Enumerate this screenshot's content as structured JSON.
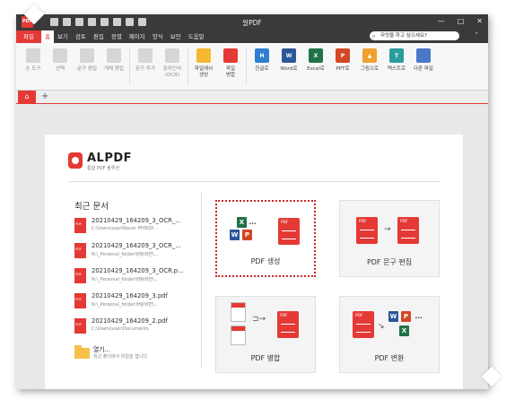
{
  "window": {
    "title": "알PDF",
    "logo_text": "PDF",
    "minimize": "—",
    "maximize": "□",
    "close": "✕"
  },
  "menu": {
    "items": [
      "파일",
      "홈",
      "보기",
      "검토",
      "편집",
      "정렬",
      "페이지",
      "양식",
      "보안",
      "도움말"
    ],
    "search_placeholder": "무엇을 하고 싶으세요?",
    "collapse": "⌃"
  },
  "ribbon": {
    "buttons": [
      {
        "label": "손 도구",
        "icon": "hand-icon",
        "dim": true
      },
      {
        "label": "선택",
        "icon": "select-icon",
        "dim": true
      },
      {
        "label": "문구 편집",
        "icon": "text-edit-icon",
        "dim": true
      },
      {
        "label": "개체 편집",
        "icon": "object-edit-icon",
        "dim": true
      },
      {
        "label": "문구 추가",
        "icon": "add-text-icon",
        "dim": true
      },
      {
        "label": "문자인식\n(OCR)",
        "icon": "ocr-icon",
        "dim": true
      },
      {
        "label": "파일에서\n생성",
        "icon": "folder-icon",
        "color": "#f5b82e"
      },
      {
        "label": "파일\n병합",
        "icon": "merge-icon",
        "color": "#e53935"
      },
      {
        "label": "한글로",
        "icon": "hwp-icon",
        "color": "#2f7fd1",
        "badge": "H"
      },
      {
        "label": "Word로",
        "icon": "word-icon",
        "color": "#2b579a",
        "badge": "W"
      },
      {
        "label": "Excel로",
        "icon": "excel-icon",
        "color": "#217346",
        "badge": "X"
      },
      {
        "label": "PPT로",
        "icon": "ppt-icon",
        "color": "#d24726",
        "badge": "P"
      },
      {
        "label": "그림으로",
        "icon": "image-icon",
        "color": "#f0a030",
        "badge": "▲"
      },
      {
        "label": "텍스트로",
        "icon": "text-icon",
        "color": "#2a9d9d",
        "badge": "T"
      },
      {
        "label": "다른 파일",
        "icon": "other-file-icon",
        "color": "#4a78c8",
        "badge": "▾"
      }
    ]
  },
  "tabs": {
    "home_icon": "⌂",
    "add": "+"
  },
  "start": {
    "brand": "ALPDF",
    "brand_sub": "통합 PDF 솔루션",
    "recent_title": "최근 문서",
    "recent": [
      {
        "name": "20210429_164209_3_OCR_...",
        "path": "C:\\Users\\user\\Naver MYBOX..."
      },
      {
        "name": "20210429_164209_3_OCR_...",
        "path": "N:\\_Personal_folder\\바탕화면\\..."
      },
      {
        "name": "20210429_164209_3_OCR.p...",
        "path": "N:\\_Personal_folder\\바탕화면\\..."
      },
      {
        "name": "20210429_164209_3.pdf",
        "path": "N:\\_Personal_folder\\바탕화면\\..."
      },
      {
        "name": "20210429_164209_2.pdf",
        "path": "C:\\Users\\user\\Documents"
      }
    ],
    "open_title": "열기...",
    "open_sub": "최근 폴더에서 파일을 엽니다.",
    "cards": {
      "create": "PDF 생성",
      "edit": "PDF 문구 편집",
      "merge": "PDF 병합",
      "convert": "PDF 변환"
    }
  }
}
